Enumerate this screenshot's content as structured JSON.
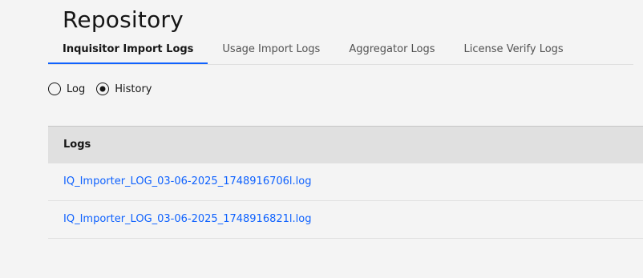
{
  "page": {
    "title": "Repository"
  },
  "tabs": [
    {
      "label": "Inquisitor Import Logs",
      "active": true
    },
    {
      "label": "Usage Import Logs",
      "active": false
    },
    {
      "label": "Aggregator Logs",
      "active": false
    },
    {
      "label": "License Verify Logs",
      "active": false
    }
  ],
  "view_options": {
    "selected": "History",
    "options": [
      {
        "label": "Log",
        "checked": false
      },
      {
        "label": "History",
        "checked": true
      }
    ]
  },
  "logs_table": {
    "header": "Logs",
    "rows": [
      {
        "filename": "IQ_Importer_LOG_03-06-2025_1748916706l.log"
      },
      {
        "filename": "IQ_Importer_LOG_03-06-2025_1748916821l.log"
      }
    ]
  },
  "colors": {
    "background": "#f4f4f4",
    "accent": "#0f62fe",
    "table_header_bg": "#e0e0e0",
    "link": "#0f62fe"
  }
}
